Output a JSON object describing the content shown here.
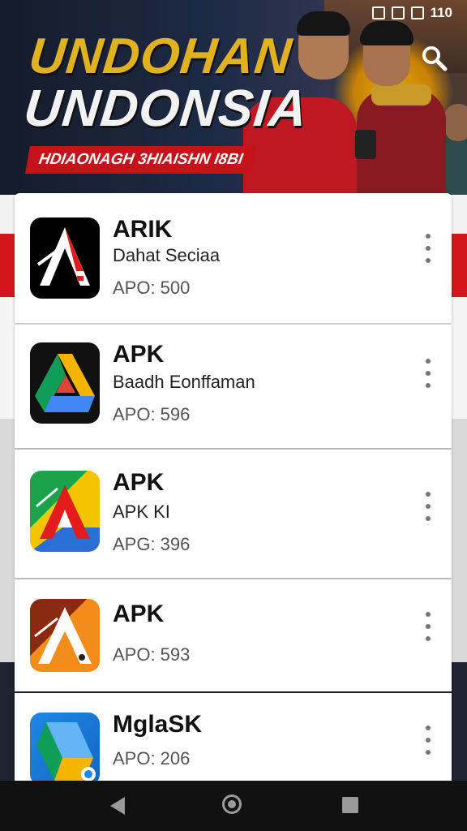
{
  "hero": {
    "title_line1": "UNDOHAN",
    "title_line2": "UNDONSIA",
    "banner": "HDIAONAGH 3HIAISHN I8BI"
  },
  "status_bar": {
    "time": "110"
  },
  "apps": [
    {
      "name": "ARIK",
      "subtitle": "Dahat Seciaa",
      "version": "APO: 500",
      "icon": "app-icon-a-black"
    },
    {
      "name": "APK",
      "subtitle": "Baadh Eonffaman",
      "version": "APO: 596",
      "icon": "app-icon-a-drive"
    },
    {
      "name": "APK",
      "subtitle": "APK KI",
      "version": "APG: 396",
      "icon": "app-icon-a-green"
    },
    {
      "name": "APK",
      "subtitle": "",
      "version": "APO: 593",
      "icon": "app-icon-a-orange"
    },
    {
      "name": "MglaSK",
      "subtitle": "",
      "version": "APO: 206",
      "icon": "app-icon-a-blue"
    }
  ],
  "colors": {
    "accent_red": "#d4161c",
    "hero_gold": "#e0b21f",
    "banner_red": "#c5121b"
  }
}
